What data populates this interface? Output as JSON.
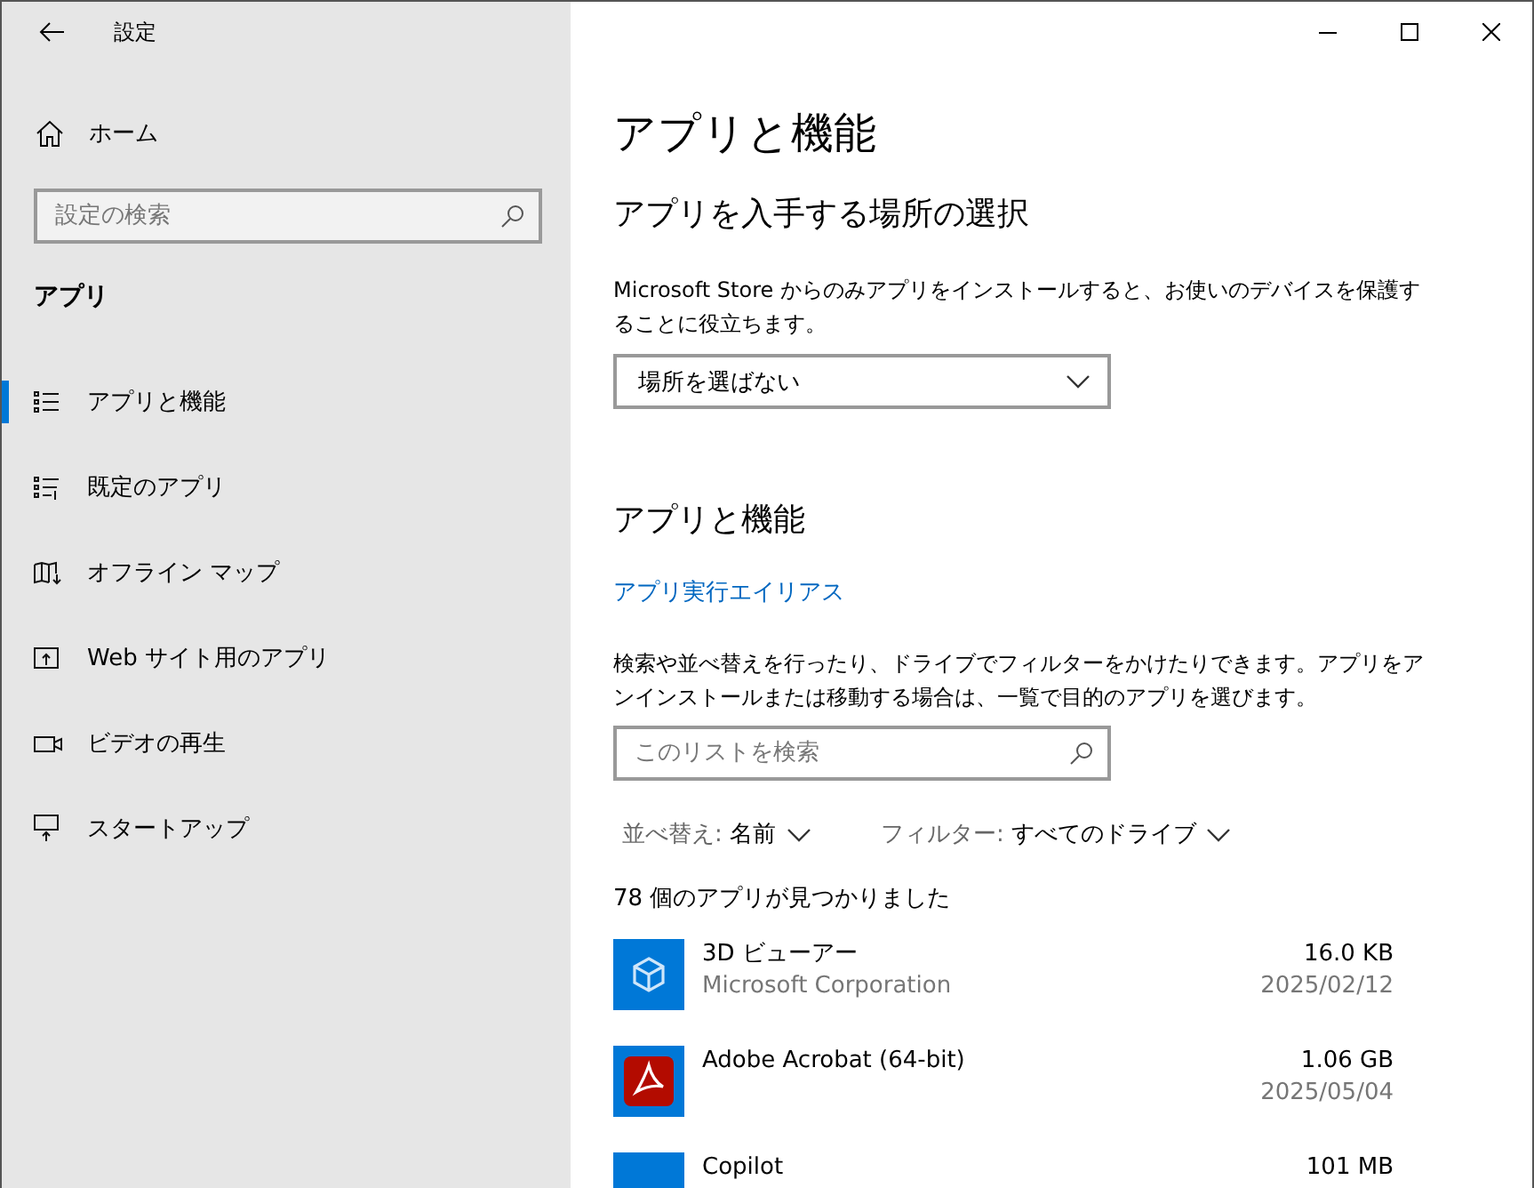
{
  "window": {
    "title": "設定"
  },
  "sidebar": {
    "home": "ホーム",
    "search": {
      "placeholder": "設定の検索"
    },
    "section": "アプリ",
    "items": [
      {
        "label": "アプリと機能",
        "kind": "list",
        "selected": true
      },
      {
        "label": "既定のアプリ",
        "kind": "defaults",
        "selected": false
      },
      {
        "label": "オフライン マップ",
        "kind": "map",
        "selected": false
      },
      {
        "label": "Web サイト用のアプリ",
        "kind": "web",
        "selected": false
      },
      {
        "label": "ビデオの再生",
        "kind": "video",
        "selected": false
      },
      {
        "label": "スタートアップ",
        "kind": "startup",
        "selected": false
      }
    ]
  },
  "main": {
    "title": "アプリと機能",
    "source": {
      "heading": "アプリを入手する場所の選択",
      "description": "Microsoft Store からのみアプリをインストールすると、お使いのデバイスを保護することに役立ちます。",
      "dropdown": {
        "value": "場所を選ばない"
      }
    },
    "apps": {
      "heading": "アプリと機能",
      "link": "アプリ実行エイリアス",
      "description": "検索や並べ替えを行ったり、ドライブでフィルターをかけたりできます。アプリをアンインストールまたは移動する場合は、一覧で目的のアプリを選びます。",
      "search": {
        "placeholder": "このリストを検索"
      },
      "sort": {
        "label": "並べ替え:",
        "value": "名前"
      },
      "filter": {
        "label": "フィルター:",
        "value": "すべてのドライブ"
      },
      "count": "78 個のアプリが見つかりました",
      "list": [
        {
          "name": "3D ビューアー",
          "publisher": "Microsoft Corporation",
          "size": "16.0 KB",
          "date": "2025/02/12",
          "kind": "cube"
        },
        {
          "name": "Adobe Acrobat (64-bit)",
          "size": "1.06 GB",
          "date": "2025/05/04",
          "kind": "acrobat"
        },
        {
          "name": "Copilot",
          "size": "101 MB",
          "kind": "copilot"
        }
      ]
    }
  }
}
